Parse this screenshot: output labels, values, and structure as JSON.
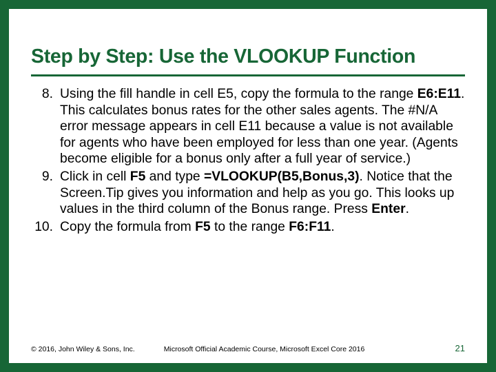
{
  "title": "Step by Step: Use the VLOOKUP Function",
  "steps": [
    {
      "num": "8.",
      "segments": [
        {
          "t": "Using the fill handle in cell E5, copy the formula to the range "
        },
        {
          "t": "E6:E11",
          "b": true
        },
        {
          "t": ". This calculates bonus rates for the other sales agents. The #N/A error message appears in cell E11 because a value is not available for agents who have been employed for less than one year. (Agents become eligible for a bonus only after a full year of service.)"
        }
      ]
    },
    {
      "num": "9.",
      "segments": [
        {
          "t": "Click in cell "
        },
        {
          "t": "F5",
          "b": true
        },
        {
          "t": " and type "
        },
        {
          "t": "=VLOOKUP(B5,Bonus,3)",
          "b": true
        },
        {
          "t": ". Notice that the Screen.Tip gives you information and help as you go. This looks up values in the third column of the Bonus range. Press "
        },
        {
          "t": "Enter",
          "b": true
        },
        {
          "t": "."
        }
      ]
    },
    {
      "num": "10.",
      "segments": [
        {
          "t": "Copy the formula from "
        },
        {
          "t": "F5",
          "b": true
        },
        {
          "t": " to the range "
        },
        {
          "t": "F6:F11",
          "b": true
        },
        {
          "t": "."
        }
      ]
    }
  ],
  "footer": {
    "copyright": "© 2016, John Wiley & Sons, Inc.",
    "course": "Microsoft Official Academic Course, Microsoft Excel Core 2016",
    "page": "21"
  }
}
